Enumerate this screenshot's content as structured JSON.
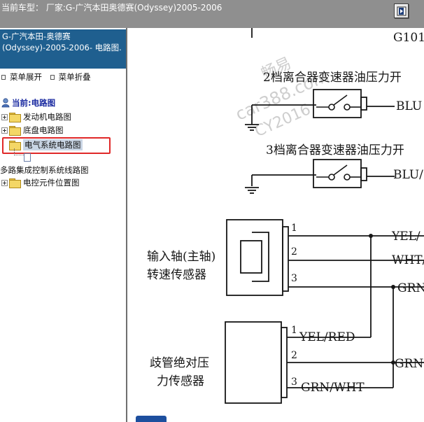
{
  "header": {
    "title": "当前车型：  厂家:G-广汽本田奥德赛(Odyssey)2005-2006"
  },
  "sidebar": {
    "title": "G-广汽本田-奥德赛(Odyssey)-2005-2006- 电路图.",
    "menu_expand": "菜单展开",
    "menu_collapse": "菜单折叠",
    "current_label": "当前:电路图",
    "items": [
      {
        "label": "发动机电路图"
      },
      {
        "label": "底盘电路图"
      },
      {
        "label": "电气系统电路图"
      },
      {
        "label": "多路集成控制系统线路图"
      },
      {
        "label": "电控元件位置图"
      }
    ]
  },
  "diagram": {
    "connector_label": "G101",
    "switch1_label": "2档离合器变速器油压力开",
    "switch1_wire": "BLU",
    "switch2_label": "3档离合器变速器油压力开",
    "switch2_wire": "BLU/",
    "sensor1_label_line1": "输入轴(主轴)",
    "sensor1_label_line2": "转速传感器",
    "sensor1_wire1": "YEL/",
    "sensor1_wire2": "WHT/",
    "sensor1_wire3": "GRN",
    "sensor2_label_line1": "歧管绝对压",
    "sensor2_label_line2": "力传感器",
    "sensor2_wire1": "YEL/RED",
    "sensor2_wire2": "GRN",
    "sensor2_wire3": "GRN/WHT",
    "pin1": "1",
    "pin2": "2",
    "pin3": "3",
    "watermark1": "畅易",
    "watermark2": "car388.com",
    "watermark3": "CY2016"
  }
}
